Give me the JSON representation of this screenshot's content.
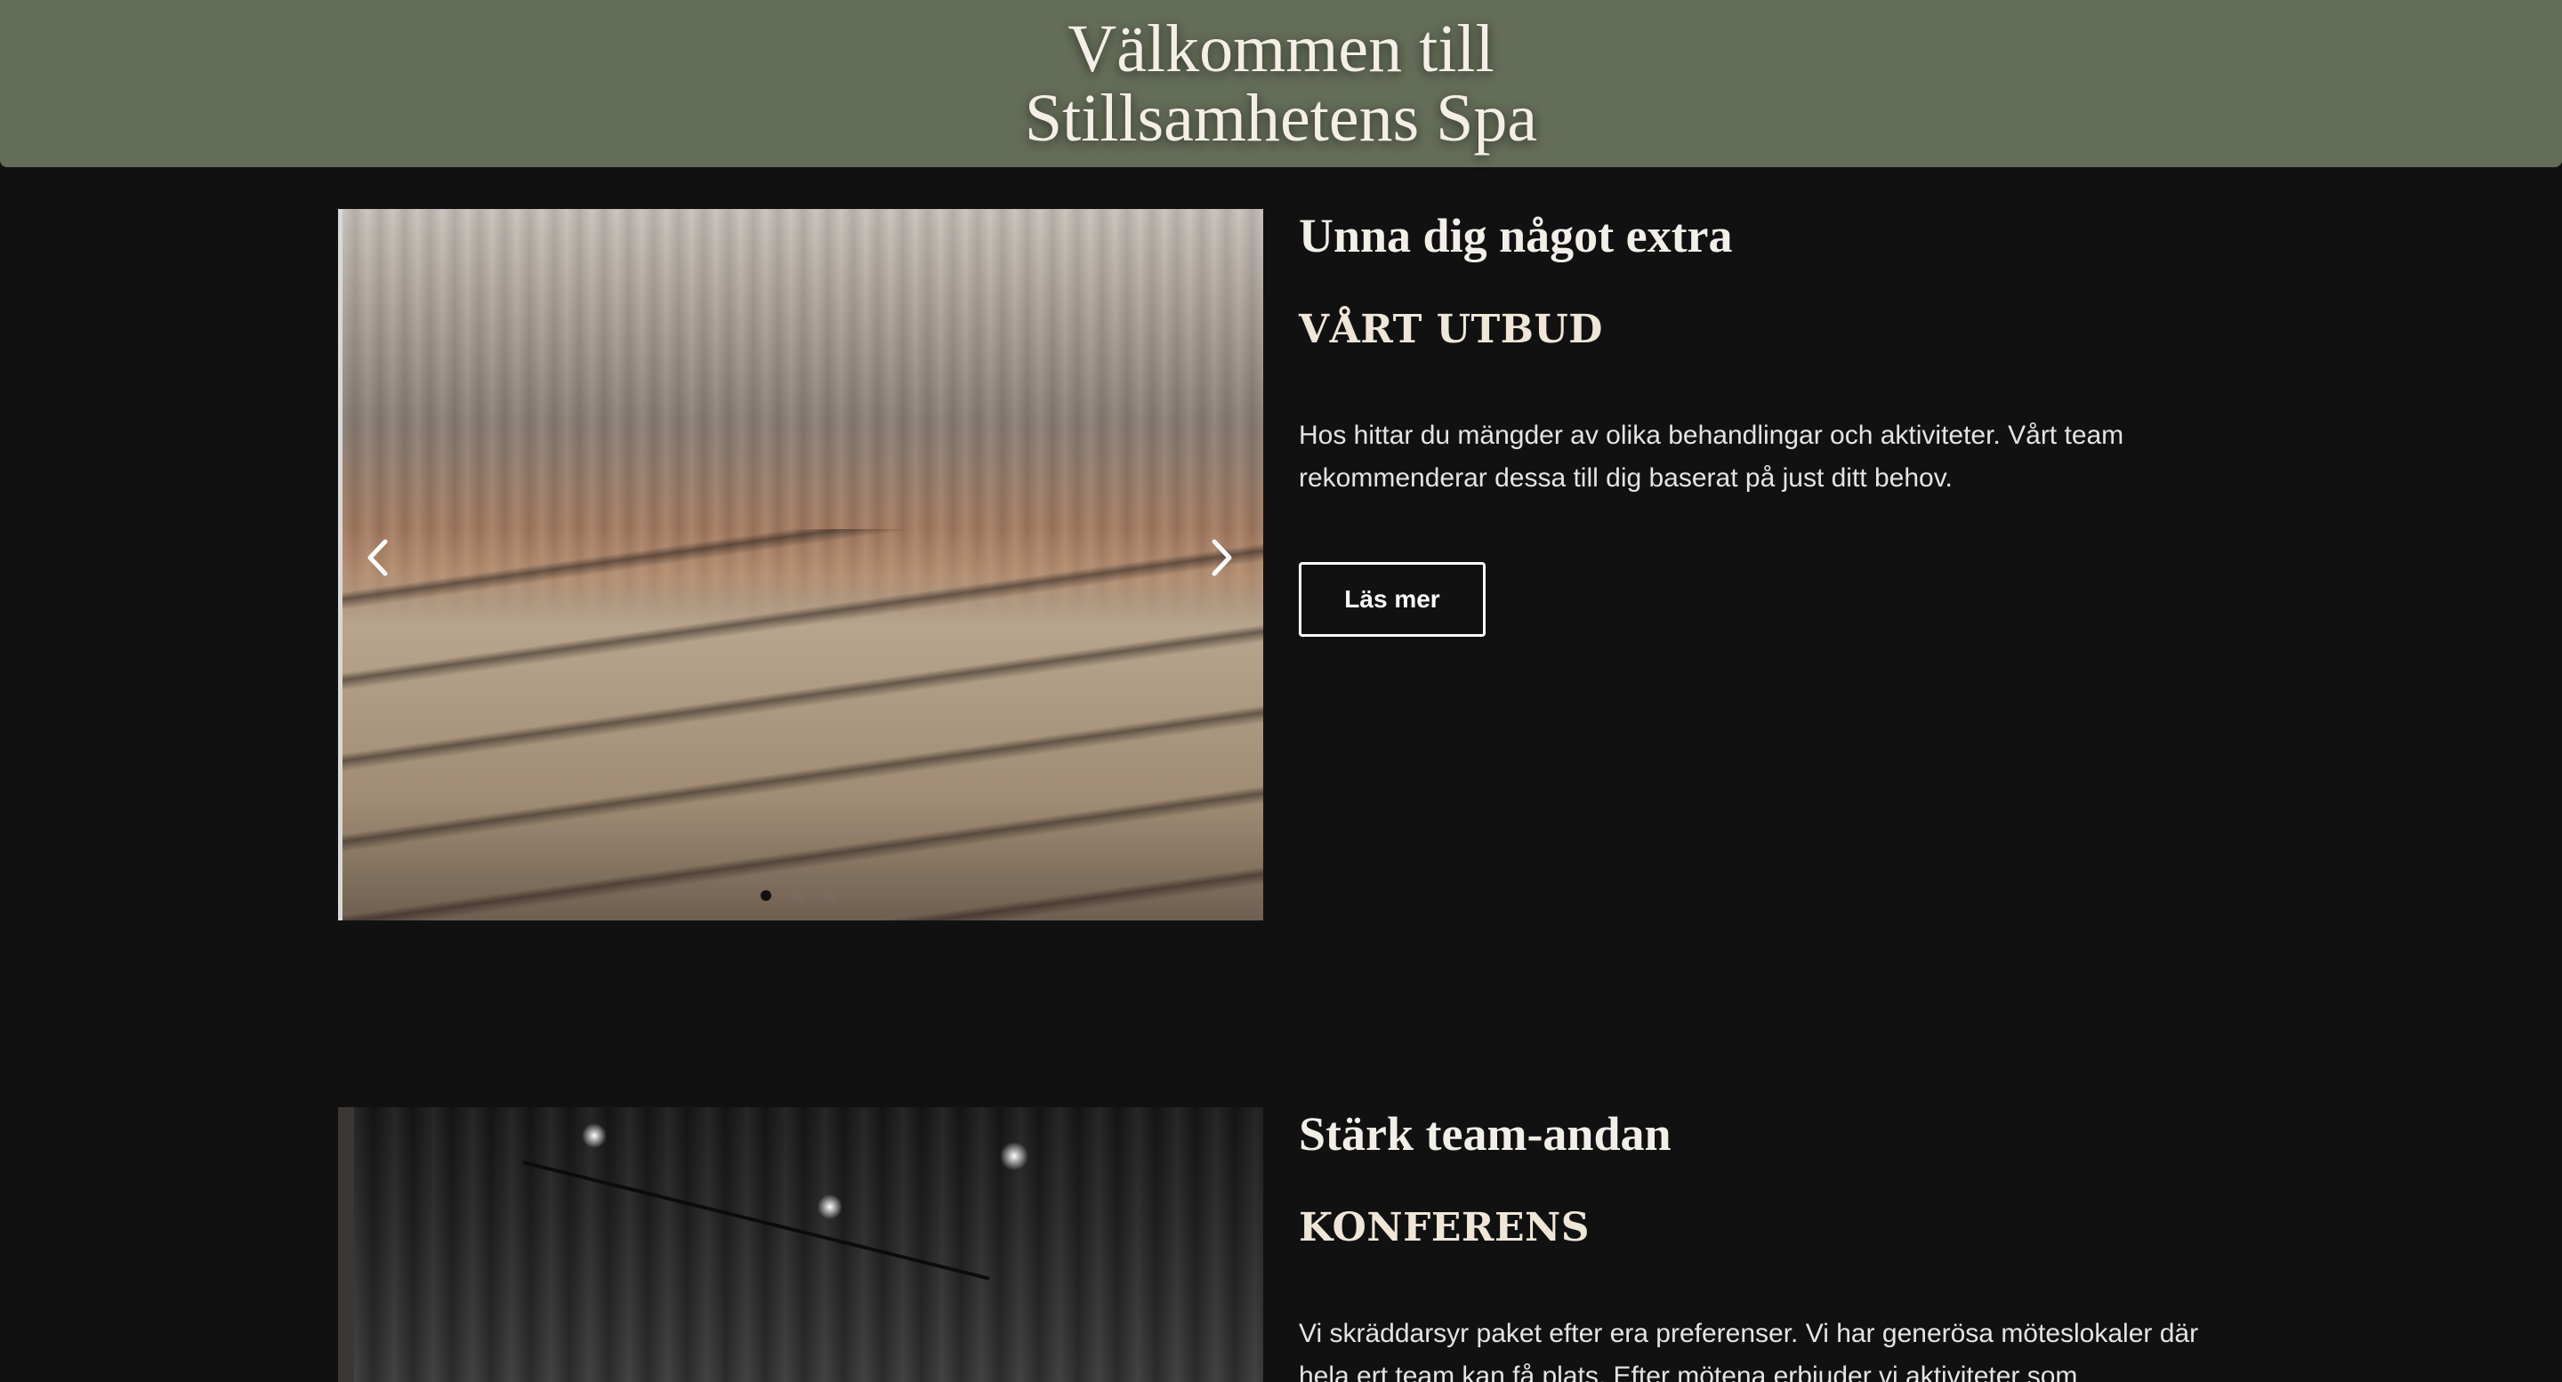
{
  "hero": {
    "title_line1": "Välkommen till",
    "title_line2": "Stillsamhetens Spa",
    "background_color": "#646d58"
  },
  "sections": [
    {
      "tagline": "Unna dig något extra",
      "heading": "VÅRT UTBUD",
      "body": "Hos hittar du mängder av olika behandlingar och aktiviteter. Vårt team rekommenderar dessa till dig baserat på just ditt behov.",
      "button_label": "Läs mer",
      "image": "spa-lounge-photo",
      "carousel": {
        "prev_icon": "chevron-left-icon",
        "next_icon": "chevron-right-icon",
        "slide_count": 3,
        "active_slide": 1
      }
    },
    {
      "tagline": "Stärk team-andan",
      "heading": "KONFERENS",
      "body": "Vi skräddarsyr paket efter era preferenser. Vi har generösa möteslokaler där hela ert team kan få plats. Efter mötena erbjuder vi aktiviteter som",
      "image": "conference-room-photo"
    }
  ],
  "colors": {
    "page_background": "#111111",
    "heading_text": "#efe6d8",
    "button_border": "#ffffff"
  }
}
